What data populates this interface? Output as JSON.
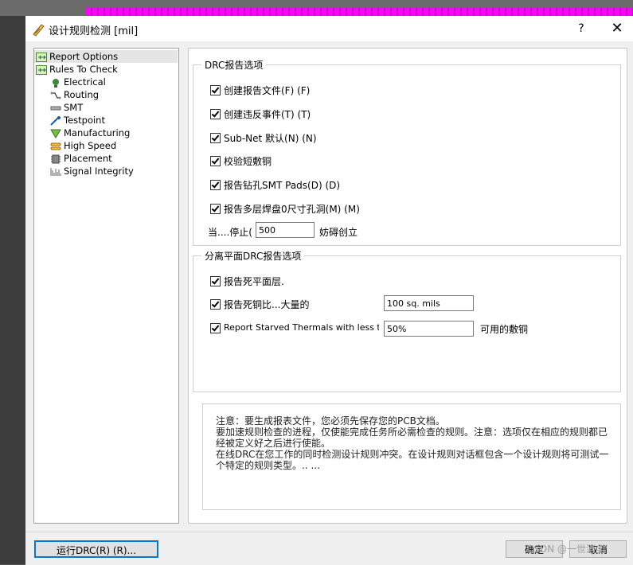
{
  "window": {
    "title": "设计规则检测 [mil]",
    "help": "?",
    "close": "✕"
  },
  "tree": {
    "items": [
      {
        "label": "Report Options",
        "icon": "report-options-icon"
      },
      {
        "label": "Rules To Check",
        "icon": "rules-to-check-icon"
      },
      {
        "label": "Electrical",
        "icon": "electrical-icon"
      },
      {
        "label": "Routing",
        "icon": "routing-icon"
      },
      {
        "label": "SMT",
        "icon": "smt-icon"
      },
      {
        "label": "Testpoint",
        "icon": "testpoint-icon"
      },
      {
        "label": "Manufacturing",
        "icon": "manufacturing-icon"
      },
      {
        "label": "High Speed",
        "icon": "high-speed-icon"
      },
      {
        "label": "Placement",
        "icon": "placement-icon"
      },
      {
        "label": "Signal Integrity",
        "icon": "signal-integrity-icon"
      }
    ]
  },
  "drc_options": {
    "group_label": "DRC报告选项",
    "items": [
      {
        "label": "创建报告文件(F) (F)",
        "checked": true
      },
      {
        "label": "创建违反事件(T) (T)",
        "checked": true
      },
      {
        "label": "Sub-Net 默认(N) (N)",
        "checked": true
      },
      {
        "label": "校验短敷铜",
        "checked": true
      },
      {
        "label": "报告钻孔SMT Pads(D) (D)",
        "checked": true
      },
      {
        "label": "报告多层焊盘0尺寸孔洞(M) (M)",
        "checked": true
      }
    ],
    "stop_prefix": "当....停止(",
    "stop_value": "500",
    "stop_suffix": "妨碍创立"
  },
  "split_plane": {
    "group_label": "分离平面DRC报告选项",
    "dead_plane": "报告死平面层.",
    "dead_copper": "报告死铜比...大量的",
    "dead_copper_value": "100 sq. mils",
    "starved": "Report Starved Thermals with less thar",
    "starved_value": "50%",
    "starved_suffix": "可用的敷铜"
  },
  "info": {
    "text": "注意：要生成报表文件，您必须先保存您的PCB文档。\n要加速规则检查的进程，仅使能完成任务所必需检查的规则。注意：选项仅在相应的规则都已经被定义好之后进行使能。\n在线DRC在您工作的同时检测设计规则冲突。在设计规则对话框包含一个设计规则将可测试一个特定的规则类型。.. ..."
  },
  "buttons": {
    "run": "运行DRC(R) (R)...",
    "ok": "确定",
    "cancel": "取消"
  },
  "watermark": "CSDN @一世消尘"
}
